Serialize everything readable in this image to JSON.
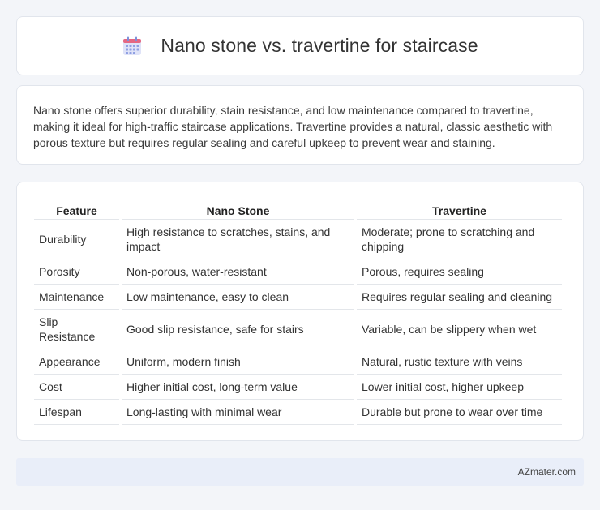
{
  "header": {
    "title": "Nano stone vs. travertine for staircase",
    "icon": "calendar-icon",
    "icon_colors": {
      "top": "#e0607a",
      "grid": "#7b8fe0",
      "body": "#d9def7"
    }
  },
  "summary": {
    "text": "Nano stone offers superior durability, stain resistance, and low maintenance compared to travertine, making it ideal for high-traffic staircase applications. Travertine provides a natural, classic aesthetic with porous texture but requires regular sealing and careful upkeep to prevent wear and staining."
  },
  "table": {
    "headers": [
      "Feature",
      "Nano Stone",
      "Travertine"
    ],
    "rows": [
      [
        "Durability",
        "High resistance to scratches, stains, and impact",
        "Moderate; prone to scratching and chipping"
      ],
      [
        "Porosity",
        "Non-porous, water-resistant",
        "Porous, requires sealing"
      ],
      [
        "Maintenance",
        "Low maintenance, easy to clean",
        "Requires regular sealing and cleaning"
      ],
      [
        "Slip Resistance",
        "Good slip resistance, safe for stairs",
        "Variable, can be slippery when wet"
      ],
      [
        "Appearance",
        "Uniform, modern finish",
        "Natural, rustic texture with veins"
      ],
      [
        "Cost",
        "Higher initial cost, long-term value",
        "Lower initial cost, higher upkeep"
      ],
      [
        "Lifespan",
        "Long-lasting with minimal wear",
        "Durable but prone to wear over time"
      ]
    ]
  },
  "footer": {
    "brand": "AZmater.com"
  }
}
